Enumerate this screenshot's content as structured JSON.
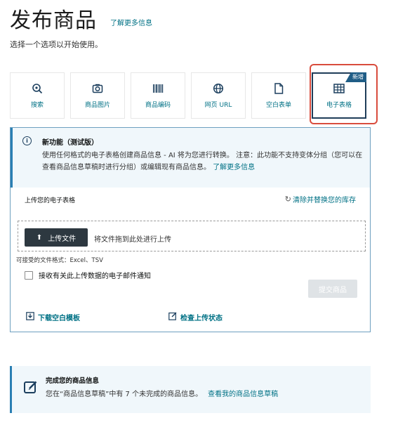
{
  "header": {
    "title": "发布商品",
    "learn_more": "了解更多信息",
    "subtitle": "选择一个选项以开始使用。"
  },
  "options": [
    {
      "label": "搜索",
      "icon": "search-icon"
    },
    {
      "label": "商品图片",
      "icon": "camera-icon"
    },
    {
      "label": "商品编码",
      "icon": "barcode-icon"
    },
    {
      "label": "网页 URL",
      "icon": "globe-icon"
    },
    {
      "label": "空白表单",
      "icon": "document-icon"
    },
    {
      "label": "电子表格",
      "icon": "spreadsheet-icon",
      "badge": "新增",
      "selected": true
    }
  ],
  "alert": {
    "title": "新功能（测试版）",
    "body": "使用任何格式的电子表格创建商品信息 - AI 将为您进行转换。 注意：此功能不支持变体分组（您可以在查看商品信息草稿时进行分组）或编辑现有商品信息。",
    "link": "了解更多信息"
  },
  "upload": {
    "label": "上传您的电子表格",
    "clear_link": "清除并替换您的库存",
    "button": "上传文件",
    "drag_text": "将文件拖到此处进行上传",
    "formats": "可接受的文件格式：Excel、TSV",
    "notify_label": "接收有关此上传数据的电子邮件通知",
    "notify_checked": false,
    "submit": "提交商品"
  },
  "links": {
    "download_template": "下载空白模板",
    "check_status": "检查上传状态"
  },
  "draft": {
    "title": "完成您的商品信息",
    "body": "您在“商品信息草稿”中有 7 个未完成的商品信息。",
    "link": "查看我的商品信息草稿"
  },
  "colors": {
    "link": "#007185",
    "accent": "#2a7fb3",
    "highlight": "#d94c3d",
    "dark_button": "#2d3840"
  }
}
